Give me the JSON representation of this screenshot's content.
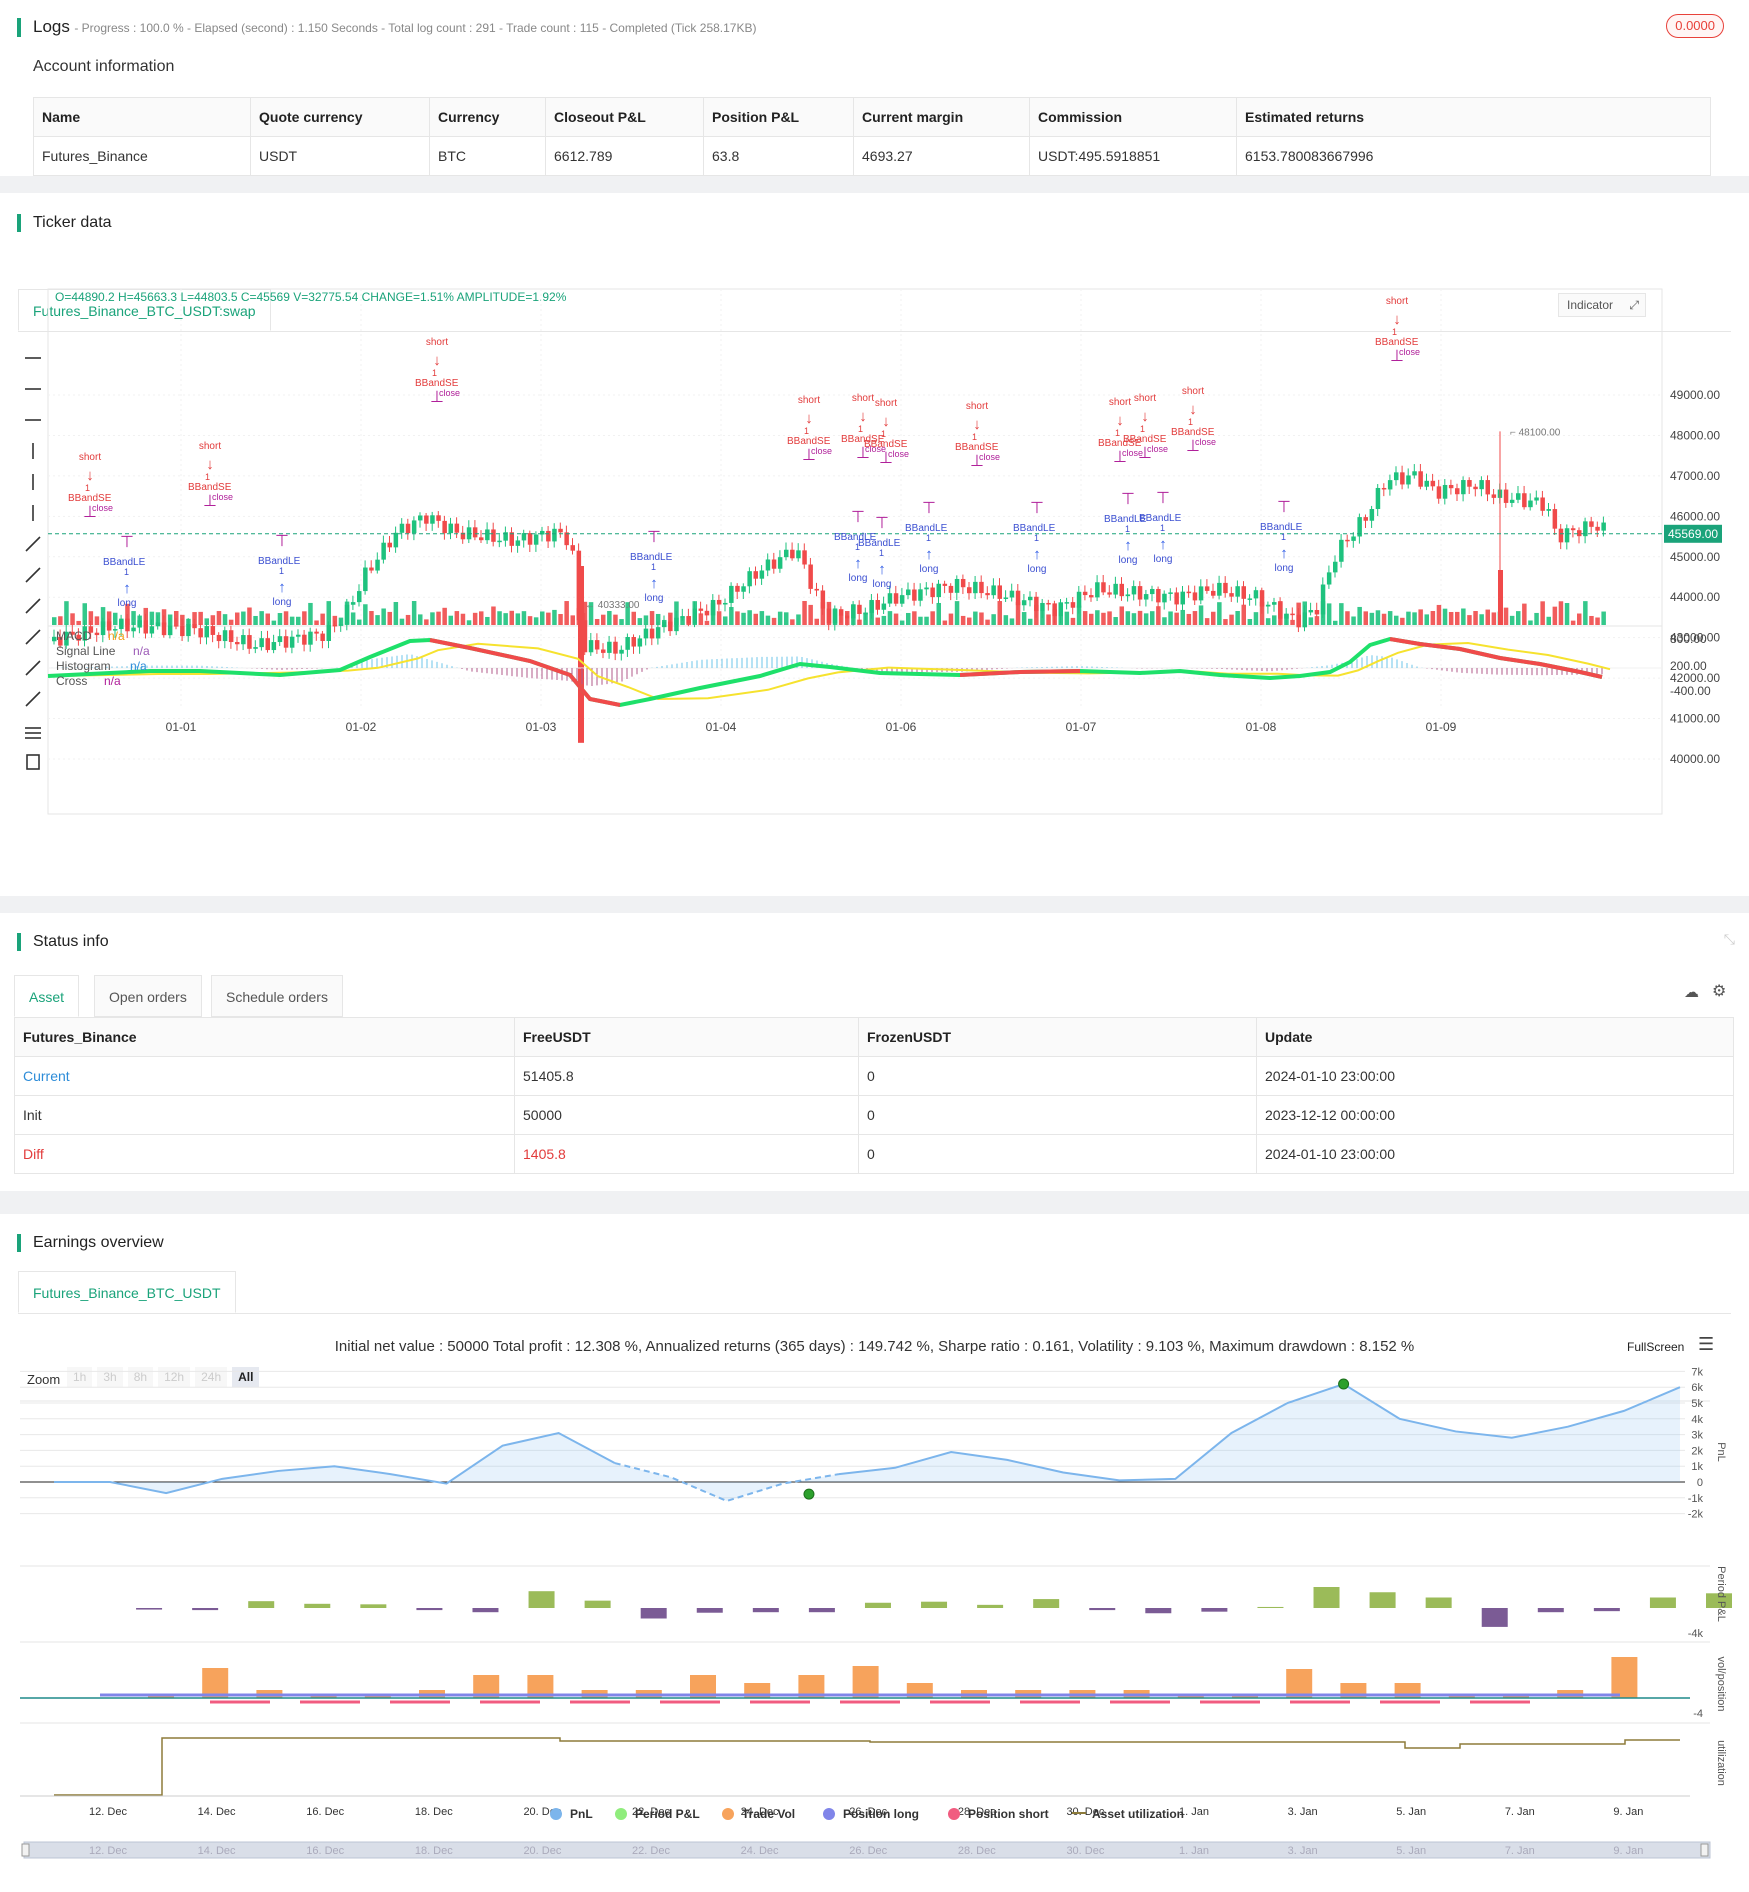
{
  "logs": {
    "title": "Logs",
    "status_line": "- Progress : 100.0 % - Elapsed (second) : 1.150  Seconds - Total log count : 291 - Trade count : 115 - Completed (Tick 258.17KB)",
    "badge": "0.0000"
  },
  "account": {
    "title": "Account information",
    "headers": [
      "Name",
      "Quote currency",
      "Currency",
      "Closeout P&L",
      "Position P&L",
      "Current margin",
      "Commission",
      "Estimated returns"
    ],
    "row": [
      "Futures_Binance",
      "USDT",
      "BTC",
      "6612.789",
      "63.8",
      "4693.27",
      "USDT:495.5918851",
      "6153.780083667996"
    ]
  },
  "ticker": {
    "title": "Ticker data",
    "tab": "Futures_Binance_BTC_USDT:swap",
    "ohlc": "O=44890.2 H=45663.3 L=44803.5 C=45569 V=32775.54 CHANGE=1.51% AMPLITUDE=1.92%",
    "indicator_btn": "Indicator",
    "price_ticks": [
      "49000.00",
      "48000.00",
      "47000.00",
      "46000.00",
      "45000.00",
      "44000.00",
      "43000.00",
      "42000.00",
      "41000.00",
      "40000.00"
    ],
    "current_price": "45569.00",
    "high_mark": "48100.00",
    "low_mark": "40333.00",
    "macd_ticks": [
      "800.00",
      "200.00",
      "-400.00"
    ],
    "legend": [
      {
        "name": "MACD",
        "value": "n/a"
      },
      {
        "name": "Signal Line",
        "value": "n/a"
      },
      {
        "name": "Histogram",
        "value": "n/a"
      },
      {
        "name": "Cross",
        "value": "n/a"
      }
    ],
    "date_ticks": [
      "01-01",
      "01-02",
      "01-03",
      "01-04",
      "01-06",
      "01-07",
      "01-08",
      "01-09"
    ],
    "markers": {
      "short": "short",
      "long": "long",
      "close": "close",
      "bbse": "BBandSE",
      "bble": "BBandLE",
      "one": "1"
    },
    "colors": {
      "up": "#1ec27e",
      "down": "#f04a4a",
      "macd": "#1ee06a",
      "signal": "#f6e22e",
      "accent": "#1aa37a"
    }
  },
  "status": {
    "title": "Status info",
    "tabs": [
      "Asset",
      "Open orders",
      "Schedule orders"
    ],
    "headers": [
      "Futures_Binance",
      "FreeUSDT",
      "FrozenUSDT",
      "Update"
    ],
    "rows": [
      [
        "Current",
        "51405.8",
        "0",
        "2024-01-10 23:00:00"
      ],
      [
        "Init",
        "50000",
        "0",
        "2023-12-12 00:00:00"
      ],
      [
        "Diff",
        "1405.8",
        "0",
        "2024-01-10 23:00:00"
      ]
    ]
  },
  "earnings": {
    "title": "Earnings overview",
    "tab": "Futures_Binance_BTC_USDT",
    "summary": "Initial net value : 50000 Total profit : 12.308 %, Annualized returns (365 days) : 149.742 %, Sharpe ratio : 0.161, Volatility : 9.103 %, Maximum drawdown : 8.152 %",
    "fullscreen": "FullScreen",
    "zoom_label": "Zoom",
    "zoom_options": [
      "1h",
      "3h",
      "8h",
      "12h",
      "24h",
      "All"
    ],
    "pnl_ticks": [
      "7k",
      "6k",
      "5k",
      "4k",
      "3k",
      "2k",
      "1k",
      "0",
      "-1k",
      "-2k"
    ],
    "period_tick": "-4k",
    "vol_tick": "-4",
    "axis_labels": [
      "PnL",
      "Period P&L",
      "vol/position",
      "utilization"
    ],
    "x_ticks": [
      "12. Dec",
      "14. Dec",
      "16. Dec",
      "18. Dec",
      "20. Dec",
      "22. Dec",
      "24. Dec",
      "26. Dec",
      "28. Dec",
      "30. Dec",
      "1. Jan",
      "3. Jan",
      "5. Jan",
      "7. Jan",
      "9. Jan"
    ],
    "legend": [
      {
        "name": "PnL",
        "color": "#7cb5ec"
      },
      {
        "name": "Period P&L",
        "color": "#90ed7d"
      },
      {
        "name": "Trade Vol",
        "color": "#f7a35c"
      },
      {
        "name": "Position long",
        "color": "#8085e9"
      },
      {
        "name": "Position short",
        "color": "#f15c80"
      },
      {
        "name": "Asset utilization",
        "color": "#8d7b3a"
      }
    ]
  },
  "chart_data": {
    "type": "line",
    "x": [
      "12. Dec",
      "13. Dec",
      "14. Dec",
      "15. Dec",
      "16. Dec",
      "17. Dec",
      "18. Dec",
      "19. Dec",
      "20. Dec",
      "21. Dec",
      "22. Dec",
      "23. Dec",
      "24. Dec",
      "25. Dec",
      "26. Dec",
      "27. Dec",
      "28. Dec",
      "29. Dec",
      "30. Dec",
      "31. Dec",
      "1. Jan",
      "2. Jan",
      "3. Jan",
      "4. Jan",
      "5. Jan",
      "6. Jan",
      "7. Jan",
      "8. Jan",
      "9. Jan",
      "10. Jan"
    ],
    "series": [
      {
        "name": "PnL",
        "values": [
          0,
          0,
          -700,
          200,
          700,
          1000,
          500,
          -100,
          2300,
          3100,
          1200,
          300,
          -1200,
          -100,
          500,
          900,
          1900,
          1400,
          600,
          100,
          200,
          3100,
          5000,
          6200,
          4000,
          3200,
          2800,
          3500,
          4500,
          6000
        ]
      },
      {
        "name": "Period P&L",
        "values": [
          0,
          -150,
          -200,
          650,
          400,
          350,
          -200,
          -400,
          1600,
          700,
          -1000,
          -450,
          -400,
          -400,
          500,
          600,
          300,
          850,
          -200,
          -500,
          -350,
          100,
          2000,
          1500,
          1000,
          -1800,
          -400,
          -300,
          1000,
          1400
        ]
      }
    ],
    "ylabel": "PnL"
  }
}
